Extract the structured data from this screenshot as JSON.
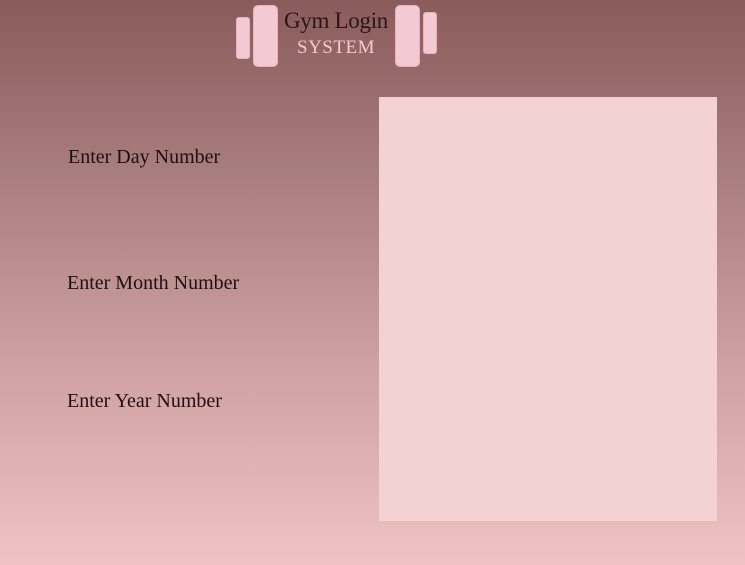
{
  "header": {
    "title": "Gym Login",
    "subtitle": "SYSTEM",
    "logo_icon": "dumbbell-icon"
  },
  "form": {
    "day_label": "Enter Day Number",
    "month_label": "Enter Month Number",
    "year_label": "Enter Year Number"
  },
  "colors": {
    "background_top": "#8a5b5b",
    "background_bottom": "#f0c2c3",
    "panel": "#f4d2d3",
    "accent": "#f3c9d3",
    "text": "#1e1010"
  }
}
